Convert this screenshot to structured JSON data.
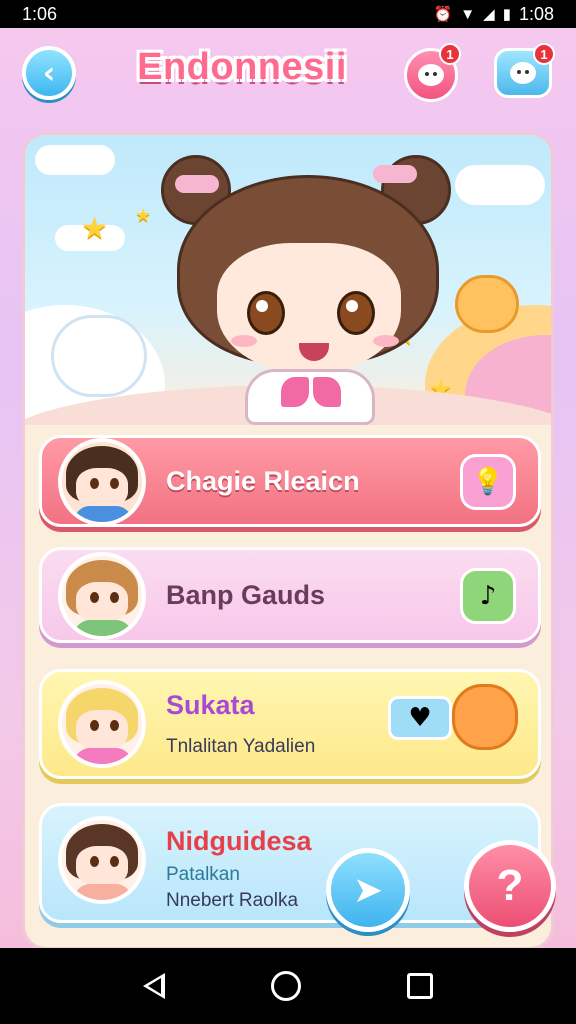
{
  "status": {
    "time_left": "1:06",
    "time_right": "1:08"
  },
  "header": {
    "title": "Endonnesii",
    "notif_badge_1": "1",
    "notif_badge_2": "1"
  },
  "items": [
    {
      "label": "Chagie Rleaicn"
    },
    {
      "label": "Banp Gauds"
    },
    {
      "label": "Sukata",
      "sub": "Tnlalitan Yadalien"
    },
    {
      "label": "Nidguidesa",
      "sub": "Patalkan",
      "sub2": "Nnebert Raolka"
    }
  ],
  "help_label": "?",
  "colors": {
    "accent_pink": "#f27283",
    "accent_blue": "#3fb7f0",
    "title_pink": "#ff6b8e"
  }
}
